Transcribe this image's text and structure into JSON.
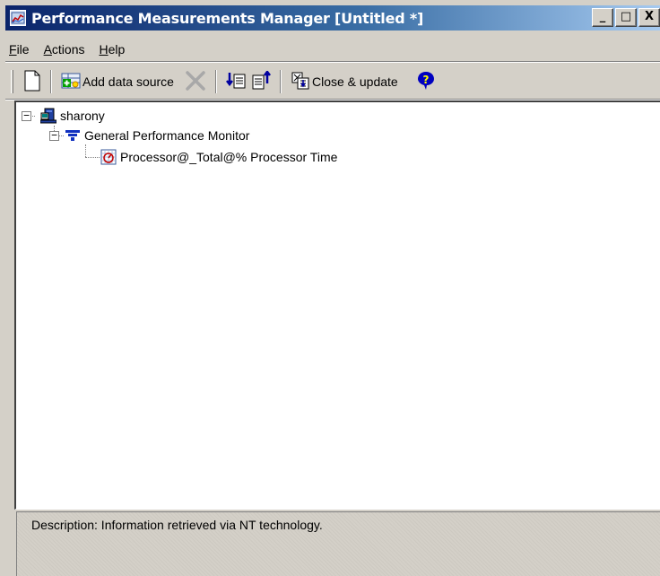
{
  "window": {
    "title": "Performance Measurements Manager [Untitled *]",
    "controls": {
      "minimize": "_",
      "maximize": "□",
      "close": "X"
    }
  },
  "menu": {
    "items": [
      {
        "mnemonic": "F",
        "rest": "ile"
      },
      {
        "mnemonic": "A",
        "rest": "ctions"
      },
      {
        "mnemonic": "H",
        "rest": "elp"
      }
    ]
  },
  "toolbar": {
    "new_icon": "new-document-icon",
    "add_data_source_label": "Add data source",
    "delete_icon": "delete-x-icon",
    "import_icon": "import-icon",
    "export_icon": "export-icon",
    "close_update_label": "Close & update",
    "help_icon": "help-icon"
  },
  "tree": {
    "root": {
      "label": "sharony",
      "icon": "computer-icon",
      "expanded": true
    },
    "child": {
      "label": "General Performance Monitor",
      "icon": "monitor-filter-icon",
      "expanded": true
    },
    "leaf": {
      "label": "Processor@_Total@% Processor Time",
      "icon": "counter-chart-icon"
    }
  },
  "description": {
    "text": "Description: Information retrieved via NT technology."
  },
  "colors": {
    "title_bar_start": "#0a246a",
    "title_bar_end": "#a6caf0",
    "face": "#d4d0c8",
    "help_blue": "#0000c0"
  }
}
